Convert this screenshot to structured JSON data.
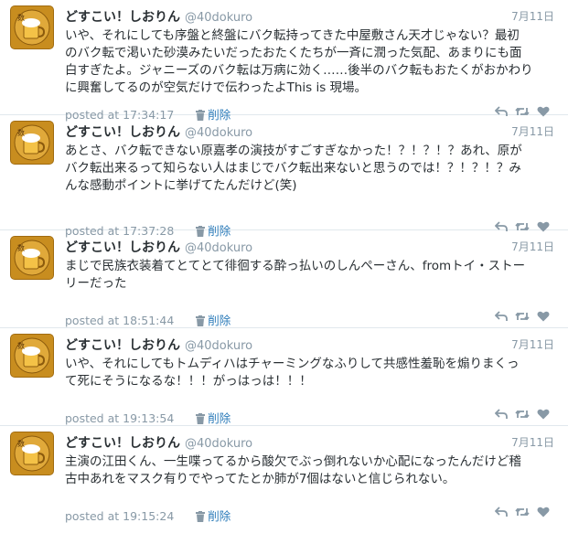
{
  "user": {
    "name": "どすこい！しおりん",
    "handle": "@40dokuro"
  },
  "labels": {
    "posted_prefix": "posted at",
    "delete": "削除"
  },
  "tweets": [
    {
      "date": "7月11日",
      "time": "17:34:17",
      "lines": [
        "いや、それにしても序盤と終盤にバク転持ってきた中屋敷さん天才じゃない？最初",
        "のバク転で渇いた砂漠みたいだったおたくたちが一斉に潤った気配、あまりにも面",
        "白すぎたよ。ジャニーズのバク転は万病に効く……後半のバク転もおたくがおかわり",
        "に興奮してるのが空気だけで伝わったよThis is 現場。"
      ]
    },
    {
      "date": "7月11日",
      "time": "17:37:28",
      "lines": [
        "あとさ、バク転できない原嘉孝の演技がすごすぎなかった！？！？！？あれ、原が",
        "バク転出来るって知らない人はまじでバク転出来ないと思うのでは！？！？！？み",
        "んな感動ポイントに挙げてたんだけど(笑)"
      ]
    },
    {
      "date": "7月11日",
      "time": "18:51:44",
      "lines": [
        "まじで民族衣装着てとてとて徘徊する酔っ払いのしんぺーさん、fromトイ・ストー",
        "リーだった"
      ]
    },
    {
      "date": "7月11日",
      "time": "19:13:54",
      "lines": [
        "いや、それにしてもトムディハはチャーミングなふりして共感性羞恥を煽りまくっ",
        "て死にそうになるな！！！がっはっは！！！"
      ]
    },
    {
      "date": "7月11日",
      "time": "19:15:24",
      "lines": [
        "主演の江田くん、一生喋ってるから酸欠でぶっ倒れないか心配になったんだけど稽",
        "古中あれをマスク有りでやってたとか肺が7個はないと信じられない。"
      ]
    }
  ],
  "icons": {
    "avatar": "beer-mug-avatar",
    "reply": "reply-icon",
    "retweet": "retweet-icon",
    "favorite": "heart-icon",
    "delete": "trash-icon"
  },
  "colors": {
    "link": "#2b7bb9",
    "muted": "#8899a6",
    "text": "#292f33",
    "avatar": "#c88d1f"
  }
}
